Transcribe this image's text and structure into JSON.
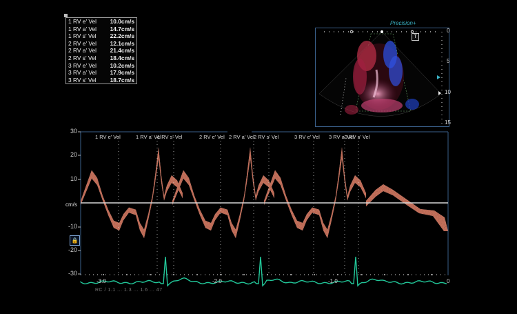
{
  "measurements": [
    {
      "label": "1 RV e' Vel",
      "value": "10.0cm/s"
    },
    {
      "label": "1 RV a' Vel",
      "value": "14.7cm/s"
    },
    {
      "label": "1 RV s' Vel",
      "value": "22.2cm/s"
    },
    {
      "label": "2 RV e' Vel",
      "value": "12.1cm/s"
    },
    {
      "label": "2 RV a' Vel",
      "value": "21.4cm/s"
    },
    {
      "label": "2 RV s' Vel",
      "value": "18.4cm/s"
    },
    {
      "label": "3 RV e' Vel",
      "value": "10.2cm/s"
    },
    {
      "label": "3 RV a' Vel",
      "value": "17.9cm/s"
    },
    {
      "label": "3 RV s' Vel",
      "value": "18.7cm/s"
    }
  ],
  "inset": {
    "mode_label": "Precision+",
    "t_badge": "T",
    "depth_ticks": [
      "0",
      "5",
      "10",
      "15"
    ]
  },
  "strip": {
    "unit": "cm/s",
    "y_ticks": [
      "30",
      "20",
      "10",
      "-10",
      "-20",
      "-30"
    ],
    "x_ticks": [
      "-3.0",
      "-2.0",
      "-1.0",
      "0"
    ],
    "event_labels": [
      "1 RV e' Vel",
      "1 RV a' Vel",
      "1 RV s' Vel",
      "2 RV e' Vel",
      "2 RV a' Vel",
      "2 RV s' Vel",
      "3 RV e' Vel",
      "3 RV a' Vel",
      "3 RV s' Vel"
    ],
    "bottom_note": "RC / 1.1 ... 1.3 ... 1.6 ... 47"
  },
  "colors": {
    "tdi": "#ff8a6a",
    "ecg": "#22c89a",
    "baseline": "#d8d8d8",
    "frame": "#3a5f8a"
  }
}
